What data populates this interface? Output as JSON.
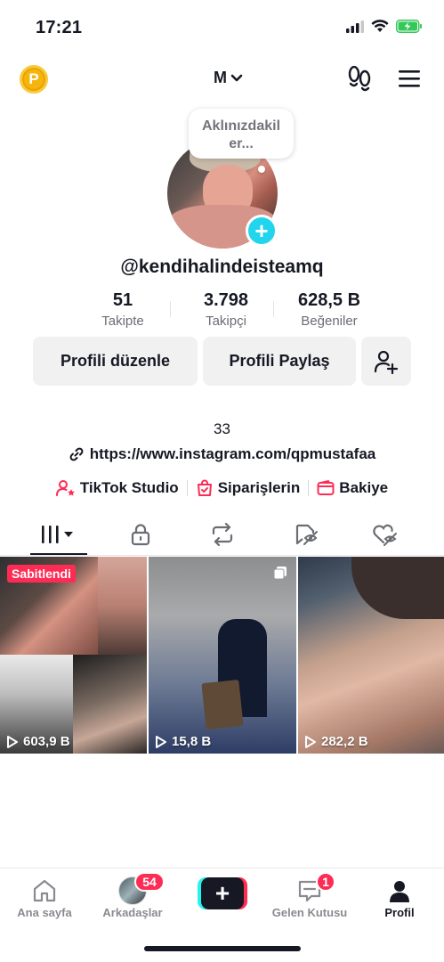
{
  "status": {
    "time": "17:21"
  },
  "header": {
    "coin_icon_label": "P",
    "account_label": "M"
  },
  "bubble": {
    "text": "Aklınızdakil er..."
  },
  "profile": {
    "username": "@kendihalindeisteamq",
    "stats": [
      {
        "value": "51",
        "label": "Takipte"
      },
      {
        "value": "3.798",
        "label": "Takipçi"
      },
      {
        "value": "628,5 B",
        "label": "Beğeniler"
      }
    ],
    "bio": "33",
    "link": "https://www.instagram.com/qpmustafaa"
  },
  "buttons": {
    "edit": "Profili düzenle",
    "share": "Profili Paylaş"
  },
  "tools": [
    {
      "label": "TikTok Studio",
      "icon": "person-star-icon"
    },
    {
      "label": "Siparişlerin",
      "icon": "shopping-bag-icon"
    },
    {
      "label": "Bakiye",
      "icon": "wallet-icon"
    }
  ],
  "tabs": [
    "videos-grid-icon",
    "lock-icon",
    "repost-icon",
    "tagged-icon",
    "liked-icon"
  ],
  "videos": [
    {
      "views": "603,9 B",
      "pinned_label": "Sabitlendi"
    },
    {
      "views": "15,8 B"
    },
    {
      "views": "282,2 B"
    }
  ],
  "bottom_nav": {
    "home": "Ana sayfa",
    "friends": "Arkadaşlar",
    "friends_badge": "54",
    "inbox": "Gelen Kutusu",
    "inbox_badge": "1",
    "profile": "Profil"
  },
  "colors": {
    "accent": "#fe2c55",
    "cyan": "#25f4ee",
    "badge_blue": "#20d5ec",
    "coin": "#f6b40e",
    "battery": "#34c759"
  }
}
